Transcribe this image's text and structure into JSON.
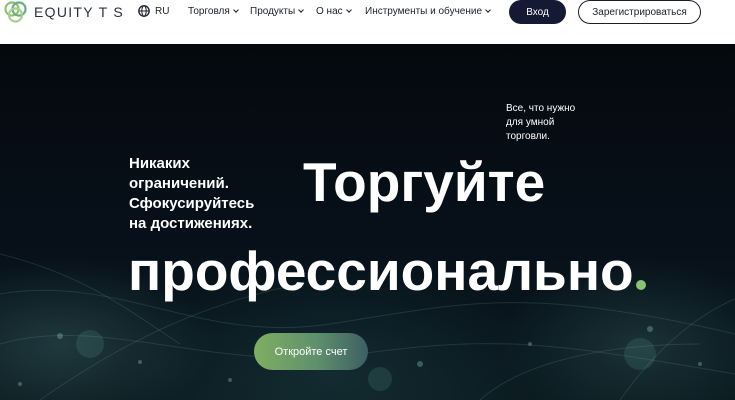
{
  "header": {
    "logo_text": "EQUITY T S",
    "language": "RU",
    "nav": [
      {
        "label": "Торговля"
      },
      {
        "label": "Продукты"
      },
      {
        "label": "О нас"
      },
      {
        "label": "Инструменты и обучение"
      }
    ],
    "login_label": "Вход",
    "register_label": "Зарегистрироваться"
  },
  "hero": {
    "tagline": [
      "Все, что нужно",
      "для умной",
      "торговли."
    ],
    "subhead": [
      "Никаких",
      "ограничений.",
      "Сфокусируйтесь",
      "на достижениях."
    ],
    "title_line1": "Торгуйте",
    "title_line2": "профессионально",
    "cta_label": "Откройте счет"
  },
  "colors": {
    "brand_navy": "#141a33",
    "accent_green": "#8cc276",
    "hero_bg": "#05090d"
  },
  "icons": {
    "logo": "interlocking-rings-logo-icon",
    "language": "globe-icon",
    "dropdown": "chevron-down-icon"
  }
}
